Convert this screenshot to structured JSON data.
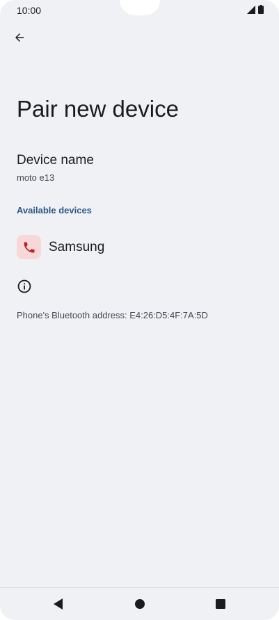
{
  "status_bar": {
    "time": "10:00",
    "icons": [
      "signal-icon",
      "battery-icon"
    ]
  },
  "header": {
    "back_icon": "arrow-back-icon",
    "title": "Pair new device"
  },
  "device_name": {
    "label": "Device name",
    "value": "moto e13"
  },
  "available_devices": {
    "header": "Available devices",
    "items": [
      {
        "icon": "phone-icon",
        "label": "Samsung"
      }
    ]
  },
  "info": {
    "icon": "info-icon",
    "bluetooth_address": "Phone's Bluetooth address: E4:26:D5:4F:7A:5D"
  },
  "nav_bar": {
    "icons": [
      "nav-back-icon",
      "nav-home-icon",
      "nav-recents-icon"
    ]
  },
  "colors": {
    "background": "#f0f1f5",
    "accent": "#2c5a86",
    "device_icon_bg": "#f8d7d8",
    "device_icon": "#b3261e"
  }
}
